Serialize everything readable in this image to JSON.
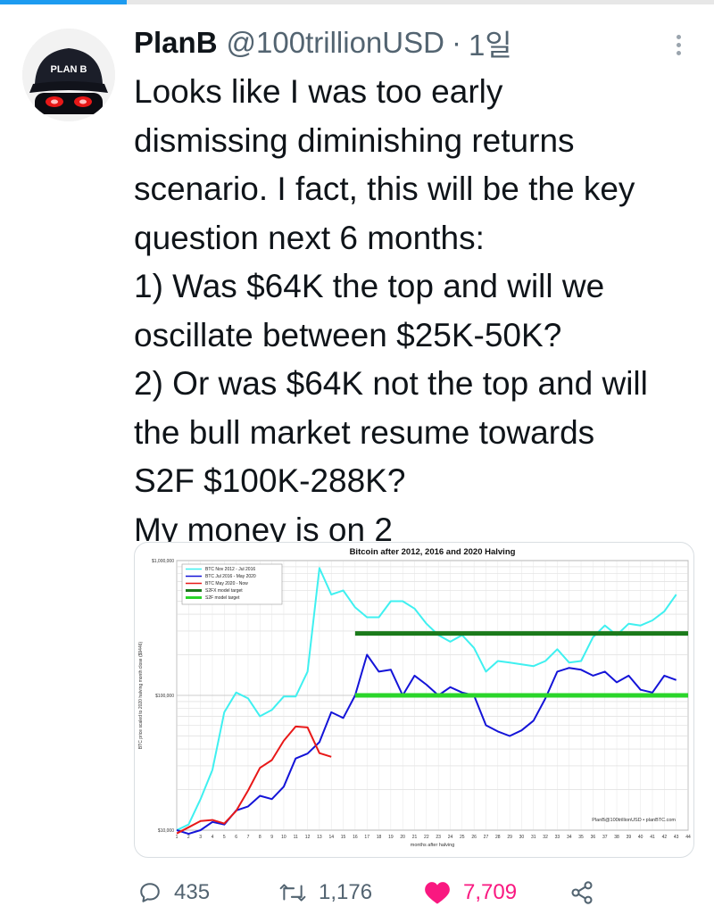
{
  "tweet": {
    "author_name": "PlanB",
    "author_handle": "@100trillionUSD",
    "separator": "·",
    "timestamp": "1일",
    "text_lines": [
      "Looks like I was too early",
      "dismissing diminishing returns",
      "scenario. I fact, this will be the key",
      "question next 6 months:",
      "1) Was $64K the top and will we",
      "oscillate between $25K-50K?",
      "2) Or was $64K not the top and will",
      "the bull market resume towards",
      "S2F $100K-288K?",
      "My money is on 2"
    ],
    "avatar_label": "PLAN B"
  },
  "actions": {
    "reply_count": "435",
    "retweet_count": "1,176",
    "like_count": "7,709"
  },
  "colors": {
    "accent": "#1d9bf0",
    "like": "#f91880",
    "muted": "#536471"
  },
  "icons": [
    "more-icon",
    "reply-icon",
    "retweet-icon",
    "heart-icon",
    "share-icon"
  ],
  "chart_data": {
    "type": "line",
    "title": "Bitcoin after 2012, 2016 and 2020 Halving",
    "xlabel": "months after halving",
    "ylabel": "BTC price scaled to 2020 halving month close ($9446)",
    "yscale": "log",
    "ylim": [
      10000,
      1000000
    ],
    "xlim": [
      1,
      44
    ],
    "y_tick_labels": [
      "$10,000",
      "$100,000",
      "$1,000,000"
    ],
    "y_tick_values": [
      10000,
      100000,
      1000000
    ],
    "x": [
      1,
      2,
      3,
      4,
      5,
      6,
      7,
      8,
      9,
      10,
      11,
      12,
      13,
      14,
      15,
      16,
      17,
      18,
      19,
      20,
      21,
      22,
      23,
      24,
      25,
      26,
      27,
      28,
      29,
      30,
      31,
      32,
      33,
      34,
      35,
      36,
      37,
      38,
      39,
      40,
      41,
      42,
      43,
      44
    ],
    "series": [
      {
        "name": "BTC Nov 2012 - Jul 2016",
        "color": "#3ff0f0",
        "values": [
          10000,
          11000,
          17000,
          28000,
          75000,
          105000,
          95000,
          70000,
          78000,
          98000,
          98000,
          150000,
          880000,
          560000,
          600000,
          450000,
          380000,
          380000,
          500000,
          500000,
          440000,
          340000,
          280000,
          250000,
          280000,
          225000,
          150000,
          180000,
          175000,
          170000,
          165000,
          180000,
          220000,
          175000,
          180000,
          270000,
          330000,
          280000,
          340000,
          330000,
          360000,
          420000,
          560000,
          null
        ]
      },
      {
        "name": "BTC Jul 2016 - May 2020",
        "color": "#1414d8",
        "values": [
          10000,
          9400,
          10000,
          11500,
          11000,
          14000,
          15000,
          18000,
          17000,
          21000,
          34000,
          37000,
          45000,
          75000,
          68000,
          100000,
          200000,
          150000,
          155000,
          100000,
          140000,
          120000,
          100000,
          115000,
          105000,
          100000,
          60000,
          54000,
          50000,
          55000,
          65000,
          95000,
          150000,
          160000,
          155000,
          140000,
          150000,
          125000,
          140000,
          110000,
          105000,
          140000,
          130000,
          null
        ]
      },
      {
        "name": "BTC May 2020 - Now",
        "color": "#e81818",
        "values": [
          9446,
          10500,
          11700,
          11900,
          11200,
          13900,
          19700,
          29000,
          33100,
          46000,
          58700,
          57800,
          37300,
          35000,
          null,
          null,
          null,
          null,
          null,
          null,
          null,
          null,
          null,
          null,
          null,
          null,
          null,
          null,
          null,
          null,
          null,
          null,
          null,
          null,
          null,
          null,
          null,
          null,
          null,
          null,
          null,
          null,
          null,
          null
        ]
      },
      {
        "name": "S2FX model target",
        "color": "#1a7a1a",
        "from_x": 16,
        "level": 288000
      },
      {
        "name": "S2F model target",
        "color": "#2ad52a",
        "from_x": 16,
        "level": 100000
      }
    ],
    "grid": true,
    "legend_position": "top-left",
    "annotation": "PlanB@100trillionUSD  •  planBTC.com"
  }
}
